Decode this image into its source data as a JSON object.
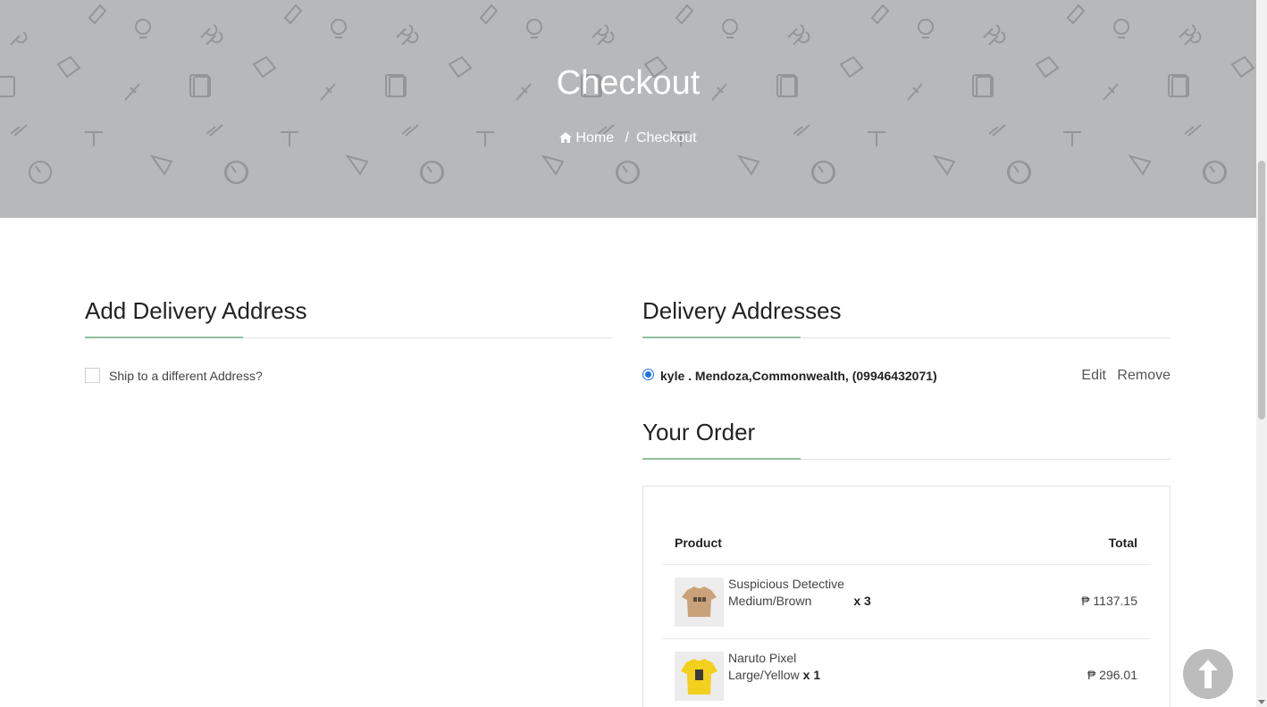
{
  "banner": {
    "title": "Checkout",
    "breadcrumb_home": "Home",
    "breadcrumb_separator": "/",
    "breadcrumb_current": "Checkout",
    "background_color": "#b7b8ba"
  },
  "add_address": {
    "title": "Add Delivery Address",
    "ship_label": "Ship to a different Address?",
    "ship_checked": false
  },
  "delivery_addresses": {
    "title": "Delivery Addresses",
    "items": [
      {
        "text": "kyle . Mendoza,Commonwealth, (09946432071)",
        "selected": true,
        "edit_label": "Edit",
        "remove_label": "Remove"
      }
    ]
  },
  "order": {
    "title": "Your Order",
    "col_product": "Product",
    "col_total": "Total",
    "items": [
      {
        "name": "Suspicious Detective",
        "variant": "Medium/Brown",
        "qty": "x 3",
        "price": "₱ 1137.15",
        "thumb_color": "#c9a27a"
      },
      {
        "name": "Naruto Pixel",
        "variant": "Large/Yellow",
        "qty": "x 1",
        "price": "₱ 296.01",
        "thumb_color": "#f3d01b"
      }
    ]
  },
  "colors": {
    "accent_underline": "#8fbf9f",
    "radio_blue": "#1a73e8",
    "scroll_top_button": "#bcbcbc"
  }
}
